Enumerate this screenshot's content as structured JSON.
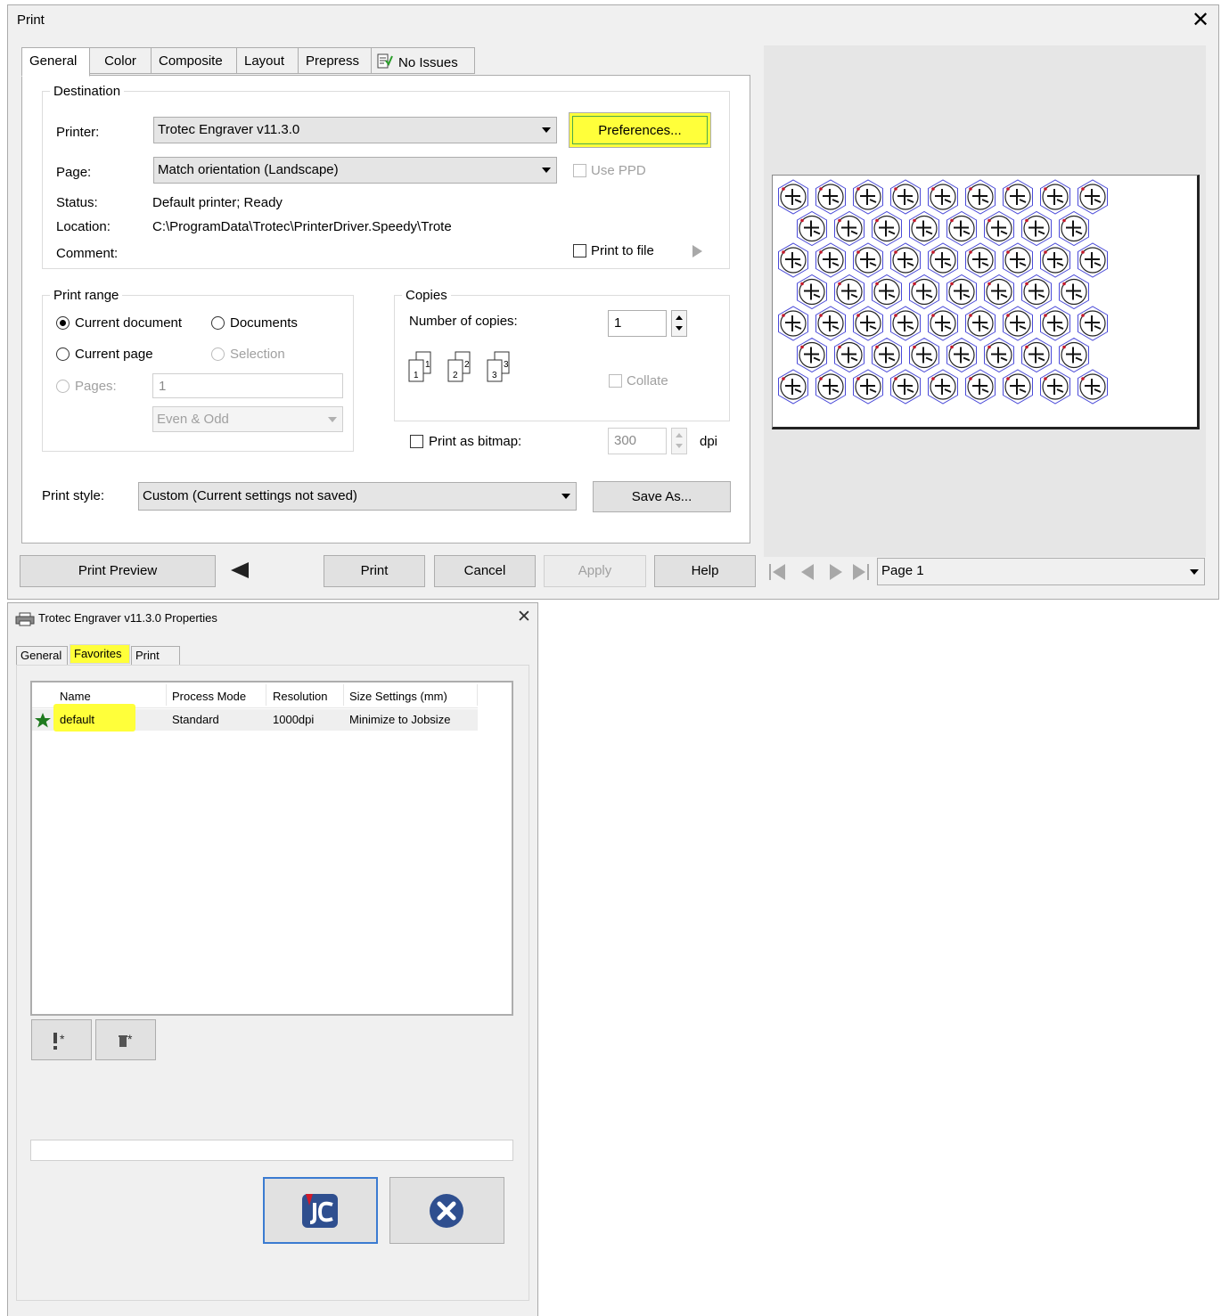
{
  "print_dialog": {
    "title": "Print",
    "tabs": [
      "General",
      "Color",
      "Composite",
      "Layout",
      "Prepress",
      "No Issues"
    ],
    "destination": {
      "legend": "Destination",
      "printer_label": "Printer:",
      "printer_value": "Trotec Engraver v11.3.0",
      "preferences_button": "Preferences...",
      "page_label": "Page:",
      "page_value": "Match orientation (Landscape)",
      "use_ppd_label": "Use PPD",
      "status_label": "Status:",
      "status_value": "Default printer; Ready",
      "location_label": "Location:",
      "location_value": "C:\\ProgramData\\Trotec\\PrinterDriver.Speedy\\Trote",
      "comment_label": "Comment:",
      "print_to_file_label": "Print to file"
    },
    "print_range": {
      "legend": "Print range",
      "current_document": "Current document",
      "documents": "Documents",
      "current_page": "Current page",
      "selection": "Selection",
      "pages_label": "Pages:",
      "pages_value": "1",
      "even_odd": "Even & Odd",
      "selected_option": "Current document"
    },
    "copies": {
      "legend": "Copies",
      "number_label": "Number of copies:",
      "number_value": "1",
      "collate_label": "Collate"
    },
    "bitmap": {
      "label": "Print as bitmap:",
      "dpi_value": "300",
      "dpi_unit": "dpi"
    },
    "print_style": {
      "label": "Print style:",
      "value": "Custom (Current settings not saved)",
      "save_as_button": "Save As..."
    },
    "buttons": {
      "print_preview": "Print Preview",
      "print": "Print",
      "cancel": "Cancel",
      "apply": "Apply",
      "help": "Help"
    },
    "page_selector": "Page 1"
  },
  "properties_dialog": {
    "title": "Trotec Engraver v11.3.0 Properties",
    "tabs": [
      "General",
      "Favorites",
      "Print"
    ],
    "active_tab": "Favorites",
    "columns": [
      "Name",
      "Process Mode",
      "Resolution",
      "Size Settings (mm)"
    ],
    "rows": [
      {
        "name": "default",
        "process_mode": "Standard",
        "resolution": "1000dpi",
        "size_settings": "Minimize to Jobsize"
      }
    ]
  },
  "colors": {
    "highlight": "#ffff3a",
    "dialog_bg": "#f0f0f0",
    "star": "#1f7a1f"
  }
}
